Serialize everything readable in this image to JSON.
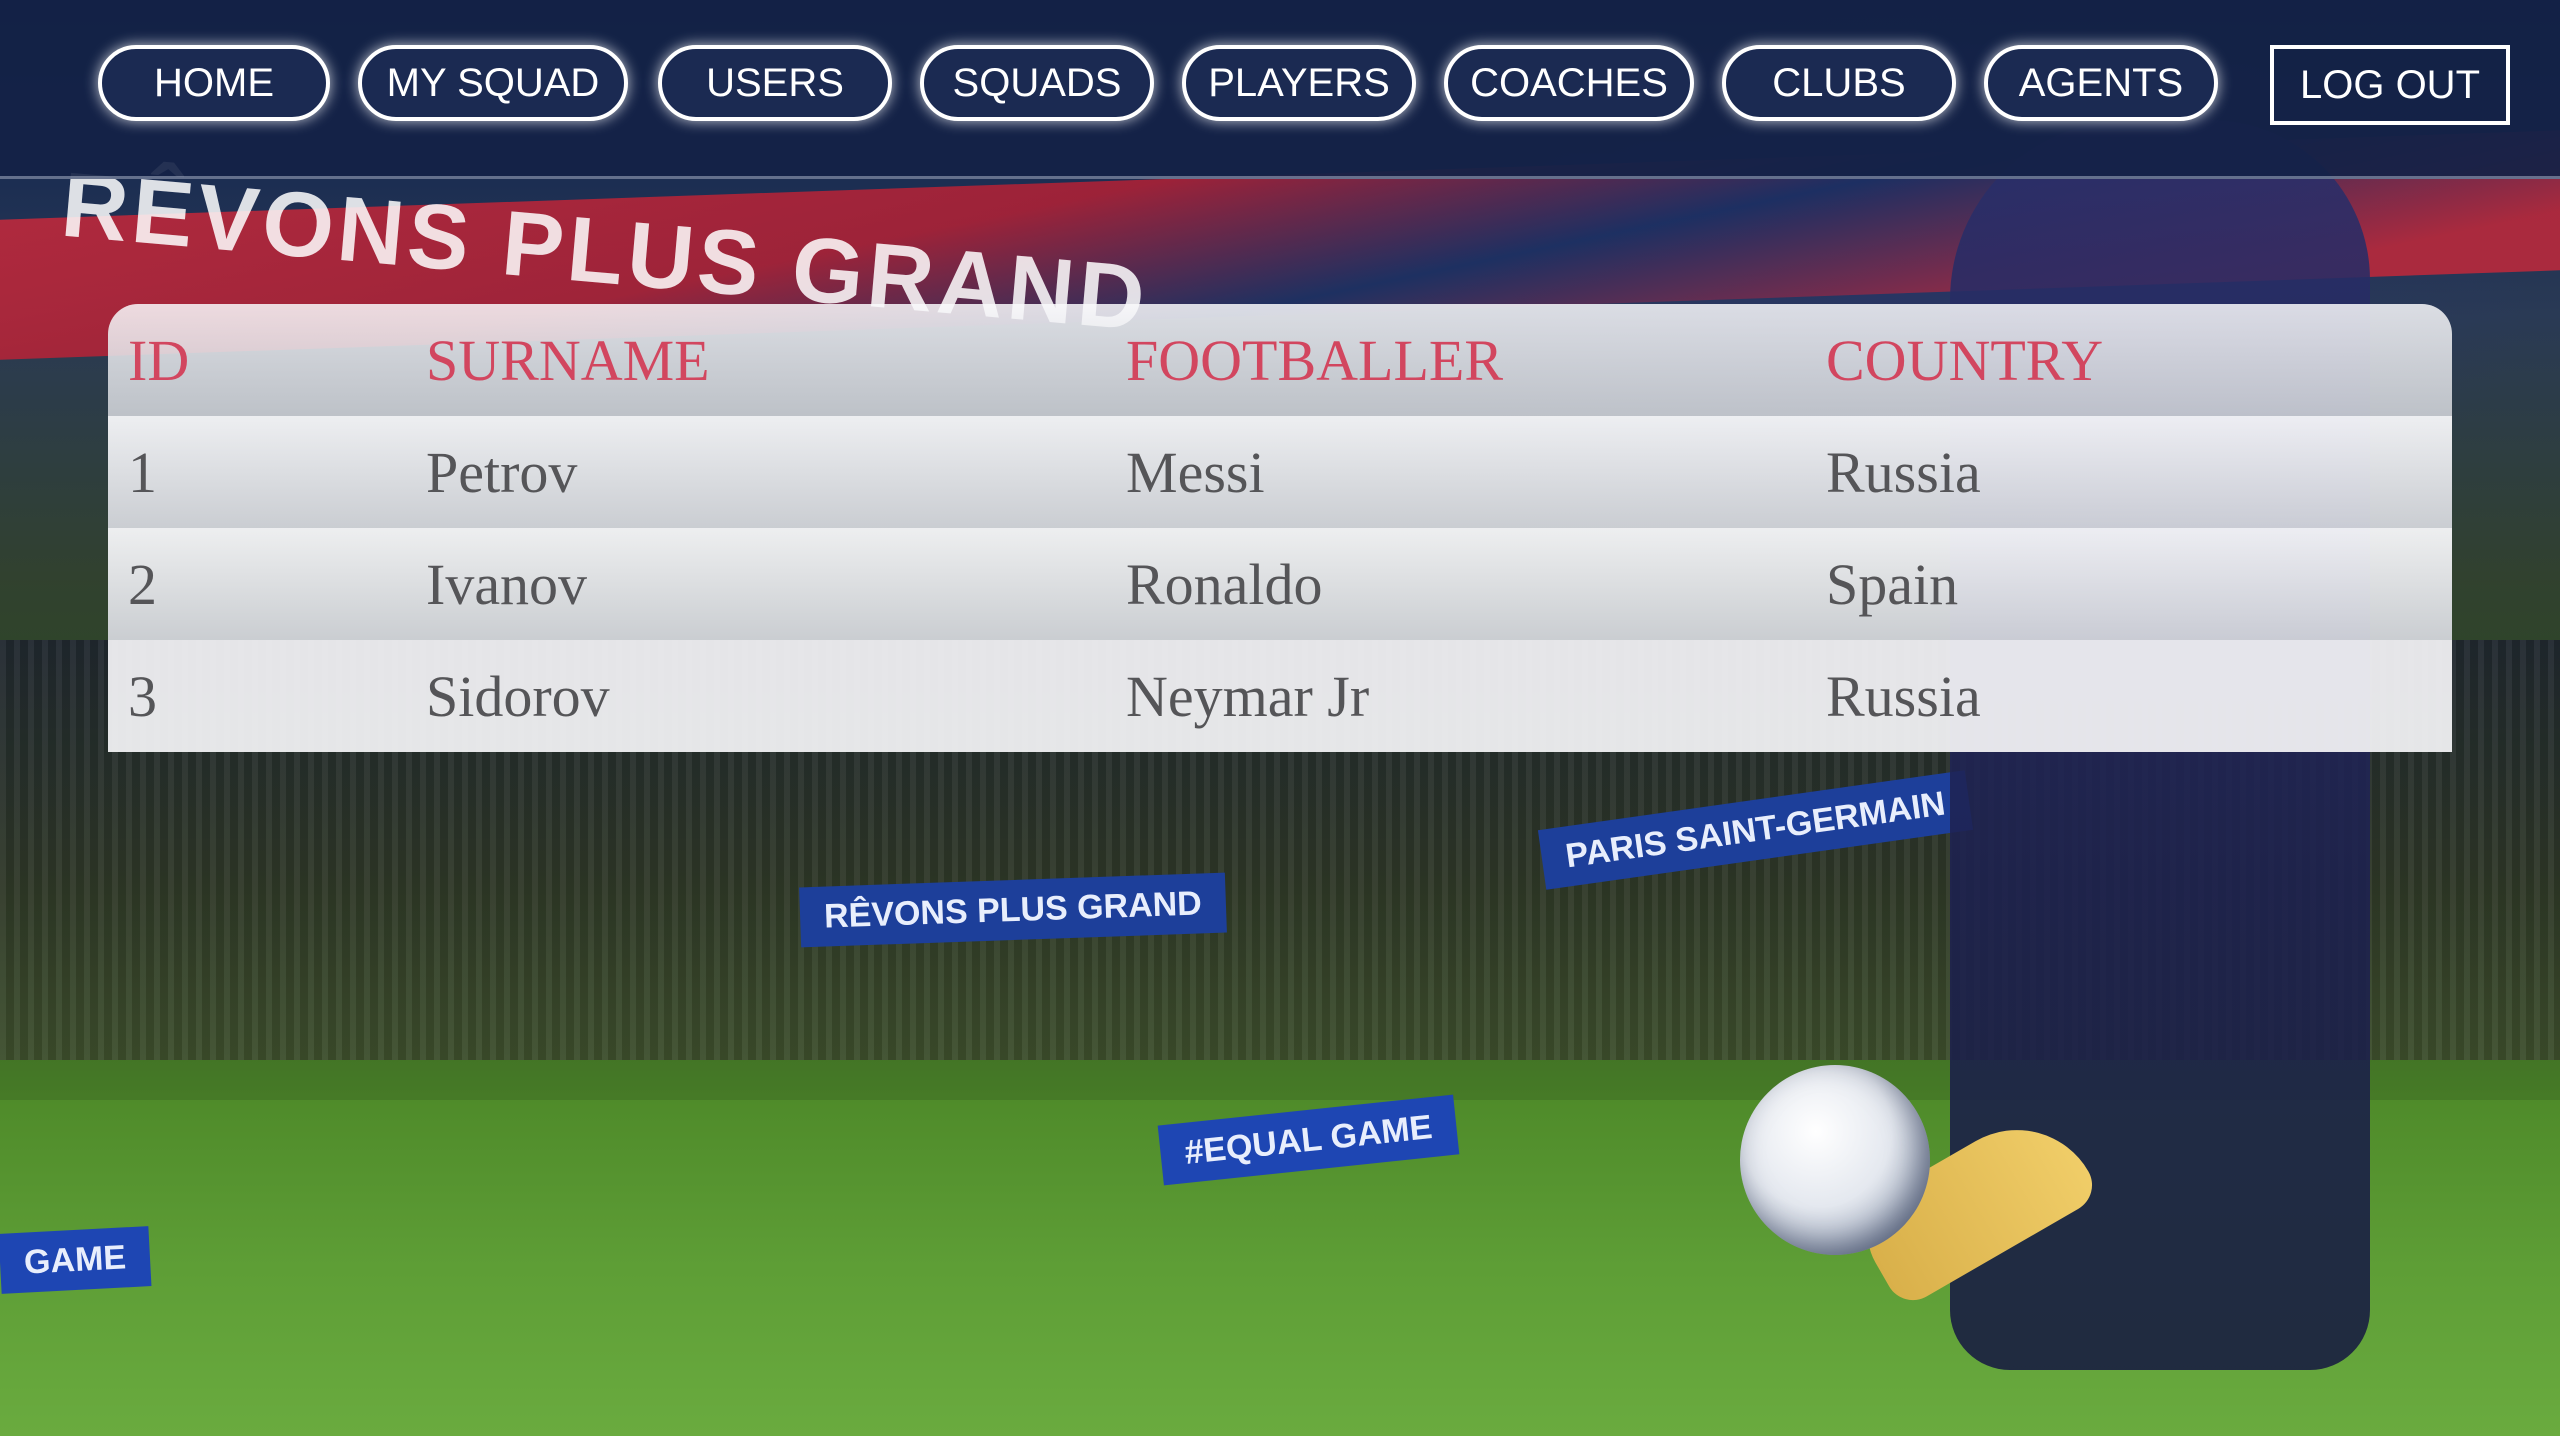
{
  "nav": {
    "items": [
      {
        "label": "HOME"
      },
      {
        "label": "MY SQUAD"
      },
      {
        "label": "USERS"
      },
      {
        "label": "SQUADS"
      },
      {
        "label": "PLAYERS"
      },
      {
        "label": "COACHES"
      },
      {
        "label": "CLUBS"
      },
      {
        "label": "AGENTS"
      }
    ],
    "logout_label": "LOG OUT"
  },
  "background": {
    "banner_text": "RÊVONS PLUS GRAND",
    "board_texts": [
      "RÊVONS PLUS GRAND",
      "PARIS SAINT-GERMAIN",
      "#EQUAL GAME",
      "GAME"
    ]
  },
  "table": {
    "headers": [
      "ID",
      "SURNAME",
      "FOOTBALLER",
      "COUNTRY"
    ],
    "rows": [
      [
        "1",
        "Petrov",
        "Messi",
        "Russia"
      ],
      [
        "2",
        "Ivanov",
        "Ronaldo",
        "Spain"
      ],
      [
        "3",
        "Sidorov",
        "Neymar Jr",
        "Russia"
      ]
    ]
  },
  "colors": {
    "nav_bg": "#142246",
    "header_text": "#d2465f",
    "cell_text": "#555558"
  }
}
